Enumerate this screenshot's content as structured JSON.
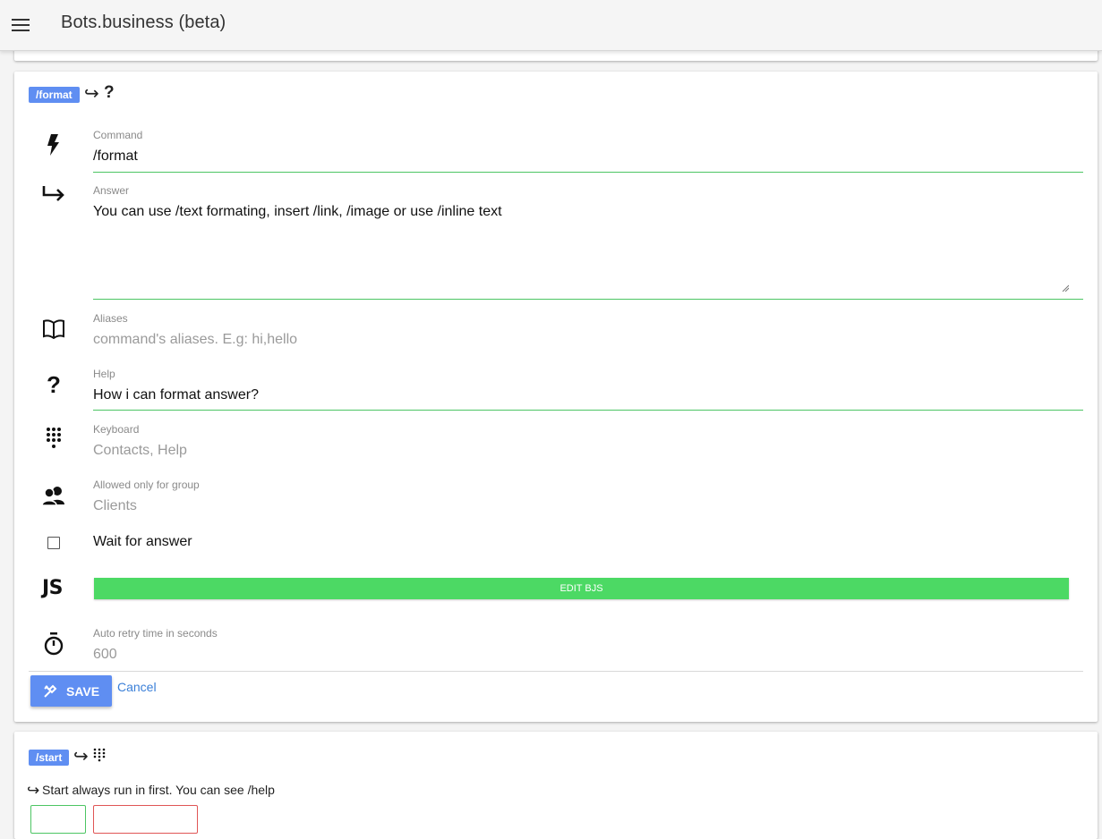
{
  "app": {
    "title": "Bots.business (beta)"
  },
  "command_card": {
    "chip": "/format",
    "header_arrow": "↪",
    "header_symbol": "?",
    "fields": {
      "command": {
        "label": "Command",
        "value": "/format"
      },
      "answer": {
        "label": "Answer",
        "value": "You can use /text formating, insert /link, /image or use /inline text"
      },
      "aliases": {
        "label": "Aliases",
        "placeholder": "command's aliases. E.g: hi,hello"
      },
      "help": {
        "label": "Help",
        "value": "How i can format answer?"
      },
      "keyboard": {
        "label": "Keyboard",
        "placeholder": "Contacts, Help"
      },
      "group": {
        "label": "Allowed only for group",
        "placeholder": "Clients"
      },
      "wait": {
        "label": "Wait for answer",
        "checked": false
      },
      "bjs": {
        "icon_text": "JS",
        "button_label": "EDIT BJS"
      },
      "retry": {
        "label": "Auto retry time in seconds",
        "placeholder": "600"
      }
    },
    "actions": {
      "save_label": "SAVE",
      "cancel_label": "Cancel"
    }
  },
  "next_card": {
    "chip": "/start",
    "header_arrow": "↪",
    "answer_arrow": "↪",
    "answer_text": "Start always run in first. You can see /help"
  },
  "colors": {
    "accent_blue": "#5f8ef2",
    "accent_green": "#4cd964",
    "underline_green": "#4cc563",
    "link_blue": "#3a7fd8"
  },
  "icons": [
    "menu-icon",
    "lightning-icon",
    "reply-arrow-icon",
    "book-icon",
    "question-icon",
    "keypad-icon",
    "group-icon",
    "checkbox-icon",
    "js-icon",
    "stopwatch-icon",
    "tools-icon"
  ]
}
